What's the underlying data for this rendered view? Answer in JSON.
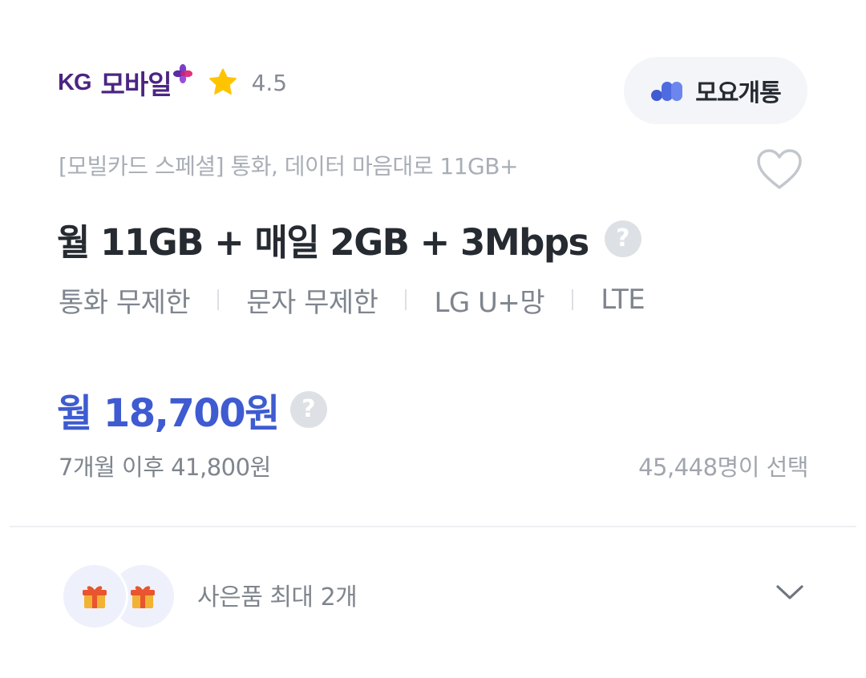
{
  "header": {
    "brand_prefix": "KG",
    "brand_name": "모바일",
    "brand_icon": "purple-plus-logo",
    "rating": "4.5",
    "rating_icon": "star-icon",
    "moyo_button_label": "모요개통",
    "moyo_icon": "moyo-logo-icon"
  },
  "plan": {
    "subtitle": "[모빌카드 스페셜] 통화, 데이터 마음대로 11GB+",
    "title": "월 11GB + 매일 2GB + 3Mbps",
    "help_glyph": "?",
    "favorite_icon": "heart-outline-icon",
    "features": [
      {
        "label": "통화 무제한"
      },
      {
        "label": "문자 무제한"
      },
      {
        "label": "LG U+망"
      },
      {
        "label": "LTE"
      }
    ]
  },
  "price": {
    "monthly": "월 18,700원",
    "after": "7개월 이후 41,800원",
    "selected_count": "45,448명이 선택"
  },
  "gifts": {
    "label": "사은품 최대 2개",
    "icon": "gift-icon",
    "expand_icon": "chevron-down-icon"
  },
  "colors": {
    "brand": "#4b2582",
    "price": "#3f5bd1",
    "star": "#ffc400",
    "moyo": "#3f5bd1"
  }
}
